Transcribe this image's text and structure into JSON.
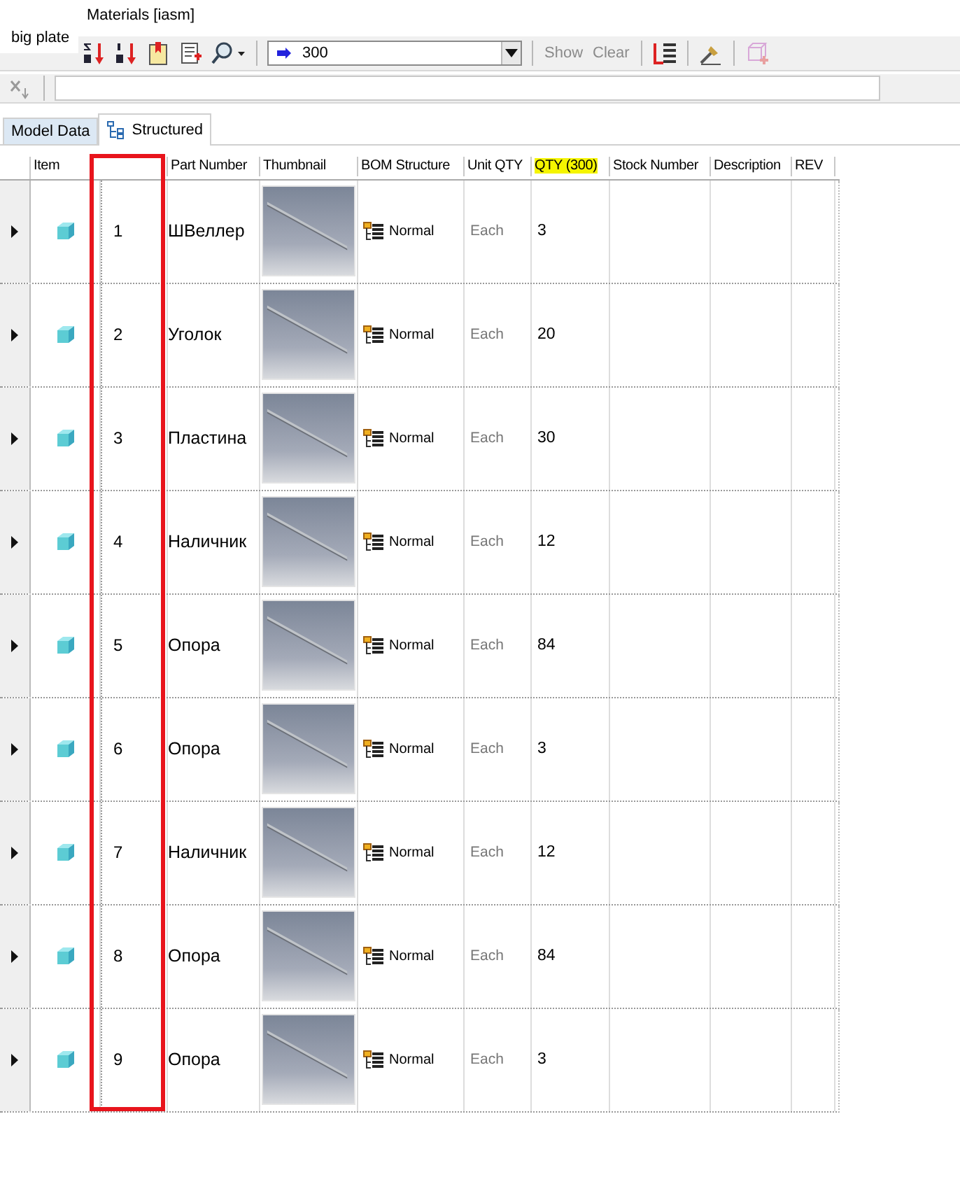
{
  "window": {
    "title": "Materials [iasm]",
    "overlay_label": "big plate"
  },
  "toolbar": {
    "quantity_value": "300",
    "buttons": [
      {
        "label": "Show",
        "disabled": true
      },
      {
        "label": "Clear",
        "disabled": true
      }
    ]
  },
  "tabs": [
    {
      "label": "Model Data",
      "selected": false
    },
    {
      "label": "Structured",
      "selected": true
    }
  ],
  "table": {
    "columns": [
      {
        "label": "Item",
        "highlighted": false
      },
      {
        "label": "Part Number",
        "highlighted": false
      },
      {
        "label": "Thumbnail",
        "highlighted": false
      },
      {
        "label": "BOM Structure",
        "highlighted": false
      },
      {
        "label": "Unit QTY",
        "highlighted": false
      },
      {
        "label": "QTY (300)",
        "highlighted": true
      },
      {
        "label": "Stock Number",
        "highlighted": false
      },
      {
        "label": "Description",
        "highlighted": false
      },
      {
        "label": "REV",
        "highlighted": false
      }
    ],
    "rows": [
      {
        "item": "1",
        "part_number": "ШВеллер",
        "bom_structure": "Normal",
        "unit_qty": "Each",
        "qty": "3"
      },
      {
        "item": "2",
        "part_number": "Уголок",
        "bom_structure": "Normal",
        "unit_qty": "Each",
        "qty": "20"
      },
      {
        "item": "3",
        "part_number": "Пластина",
        "bom_structure": "Normal",
        "unit_qty": "Each",
        "qty": "30"
      },
      {
        "item": "4",
        "part_number": "Наличник",
        "bom_structure": "Normal",
        "unit_qty": "Each",
        "qty": "12"
      },
      {
        "item": "5",
        "part_number": "Опора",
        "bom_structure": "Normal",
        "unit_qty": "Each",
        "qty": "84"
      },
      {
        "item": "6",
        "part_number": "Опора",
        "bom_structure": "Normal",
        "unit_qty": "Each",
        "qty": "3"
      },
      {
        "item": "7",
        "part_number": "Наличник",
        "bom_structure": "Normal",
        "unit_qty": "Each",
        "qty": "12"
      },
      {
        "item": "8",
        "part_number": "Опора",
        "bom_structure": "Normal",
        "unit_qty": "Each",
        "qty": "84"
      },
      {
        "item": "9",
        "part_number": "Опора",
        "bom_structure": "Normal",
        "unit_qty": "Each",
        "qty": "3"
      }
    ]
  }
}
